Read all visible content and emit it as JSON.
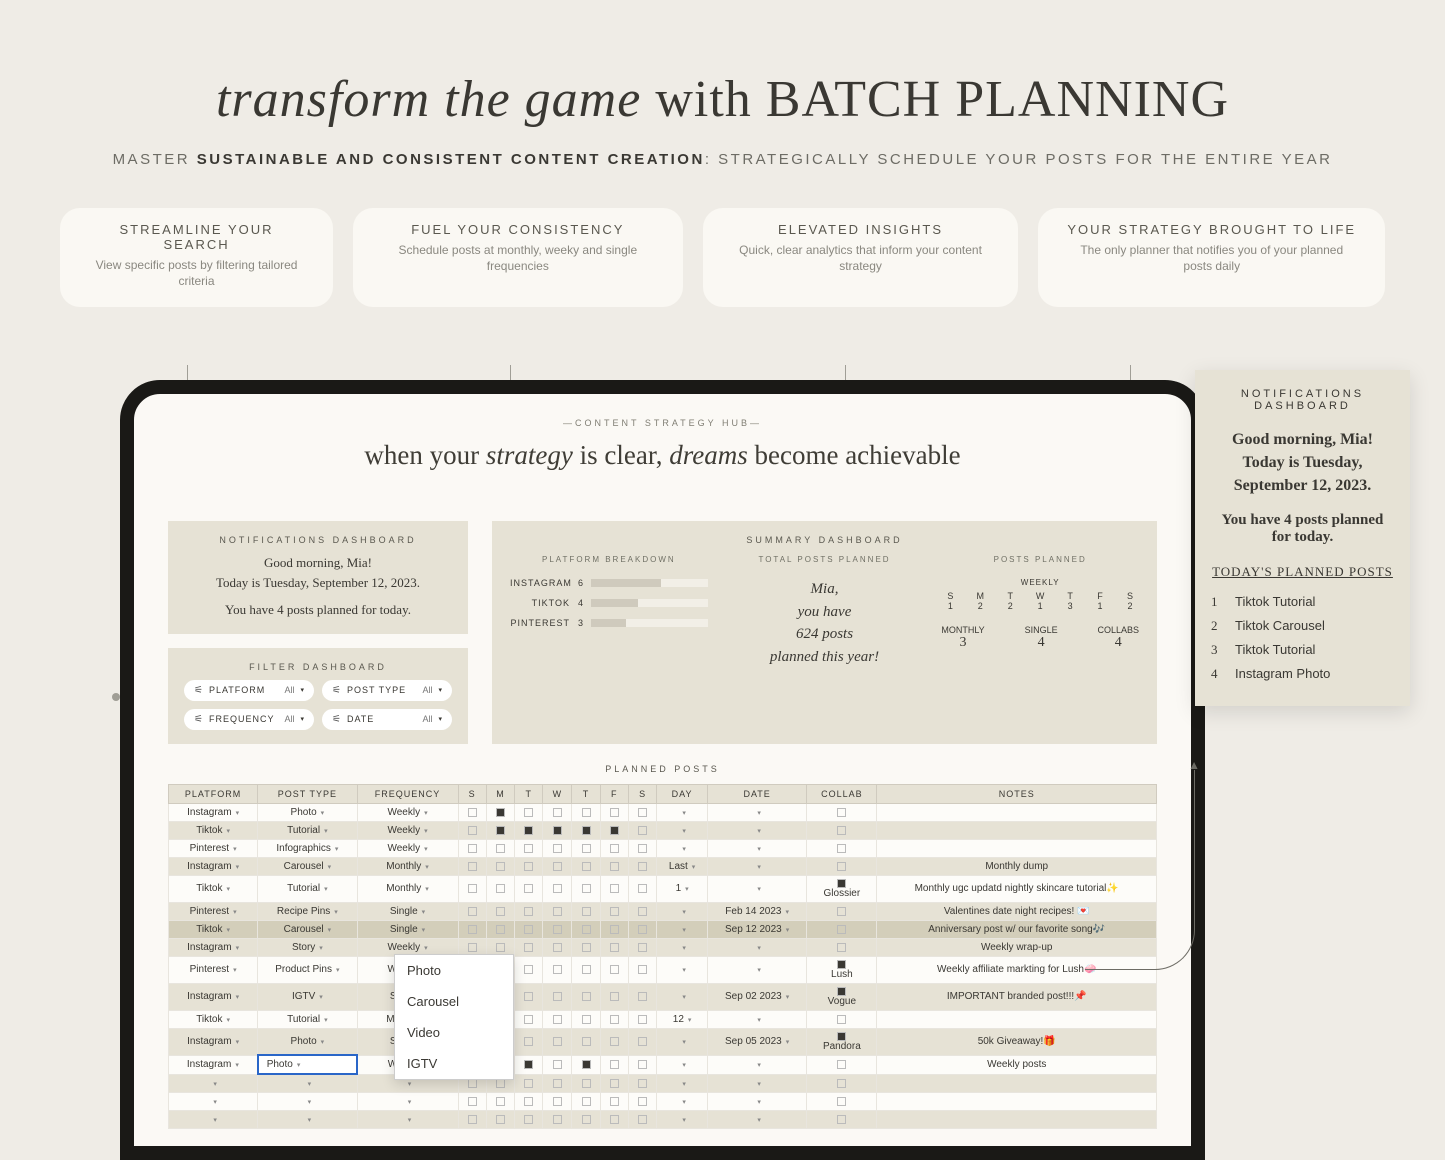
{
  "hero": {
    "title_italic": "transform the game",
    "title_join": " with ",
    "title_caps": "BATCH PLANNING"
  },
  "subhead": {
    "prefix": "MASTER ",
    "bold": "SUSTAINABLE AND CONSISTENT CONTENT CREATION",
    "suffix": ": STRATEGICALLY SCHEDULE YOUR POSTS FOR THE ENTIRE YEAR"
  },
  "pills": [
    {
      "title": "STREAMLINE YOUR SEARCH",
      "body": "View specific posts by filtering tailored criteria"
    },
    {
      "title": "FUEL YOUR CONSISTENCY",
      "body": "Schedule posts at monthly, weeky and single frequencies"
    },
    {
      "title": "ELEVATED INSIGHTS",
      "body": "Quick, clear analytics that inform your content strategy"
    },
    {
      "title": "YOUR STRATEGY BROUGHT TO LIFE",
      "body": "The only planner  that notifies you of your planned posts daily"
    }
  ],
  "hub": {
    "label": "—CONTENT STRATEGY HUB—",
    "tagline_pre": "when your ",
    "tagline_i1": "strategy",
    "tagline_mid": " is clear, ",
    "tagline_i2": "dreams",
    "tagline_post": " become achievable"
  },
  "notif_small": {
    "title": "NOTIFICATIONS DASHBOARD",
    "l1": "Good morning, Mia!",
    "l2": "Today is Tuesday, September 12, 2023.",
    "l3": "You have 4 posts planned for today."
  },
  "filter": {
    "title": "FILTER DASHBOARD",
    "chips": [
      {
        "label": "PLATFORM",
        "val": "All"
      },
      {
        "label": "POST TYPE",
        "val": "All"
      },
      {
        "label": "FREQUENCY",
        "val": "All"
      },
      {
        "label": "DATE",
        "val": "All"
      }
    ]
  },
  "summary": {
    "title": "SUMMARY DASHBOARD",
    "breakdown_title": "PLATFORM BREAKDOWN",
    "breakdown": [
      {
        "name": "INSTAGRAM",
        "n": "6",
        "pct": 60
      },
      {
        "name": "TIKTOK",
        "n": "4",
        "pct": 40
      },
      {
        "name": "PINTEREST",
        "n": "3",
        "pct": 30
      }
    ],
    "total_title": "TOTAL POSTS PLANNED",
    "total_lines": [
      "Mia,",
      "you have",
      "624 posts",
      "planned this year!"
    ],
    "planned_title": "POSTS PLANNED",
    "weekly_label": "WEEKLY",
    "days": [
      "S",
      "M",
      "T",
      "W",
      "T",
      "F",
      "S"
    ],
    "day_vals": [
      "1",
      "2",
      "2",
      "1",
      "3",
      "1",
      "2"
    ],
    "mini": [
      {
        "label": "MONTHLY",
        "n": "3"
      },
      {
        "label": "SINGLE",
        "n": "4"
      },
      {
        "label": "COLLABS",
        "n": "4"
      }
    ]
  },
  "table": {
    "title": "PLANNED POSTS",
    "headers": [
      "PLATFORM",
      "POST TYPE",
      "FREQUENCY",
      "S",
      "M",
      "T",
      "W",
      "T",
      "F",
      "S",
      "DAY",
      "DATE",
      "COLLAB",
      "NOTES"
    ],
    "rows": [
      {
        "alt": false,
        "plat": "Instagram",
        "type": "Photo",
        "freq": "Weekly",
        "days": [
          0,
          1,
          0,
          0,
          0,
          0,
          0
        ],
        "day": "",
        "date": "",
        "collab": false,
        "notes": ""
      },
      {
        "alt": true,
        "plat": "Tiktok",
        "type": "Tutorial",
        "freq": "Weekly",
        "days": [
          0,
          1,
          1,
          1,
          1,
          1,
          0
        ],
        "day": "",
        "date": "",
        "collab": false,
        "notes": ""
      },
      {
        "alt": false,
        "plat": "Pinterest",
        "type": "Infographics",
        "freq": "Weekly",
        "days": [
          0,
          0,
          0,
          0,
          0,
          0,
          0
        ],
        "day": "",
        "date": "",
        "collab": false,
        "notes": ""
      },
      {
        "alt": true,
        "plat": "Instagram",
        "type": "Carousel",
        "freq": "Monthly",
        "days": [
          0,
          0,
          0,
          0,
          0,
          0,
          0
        ],
        "day": "Last",
        "date": "",
        "collab": false,
        "notes": "Monthly dump"
      },
      {
        "alt": false,
        "plat": "Tiktok",
        "type": "Tutorial",
        "freq": "Monthly",
        "days": [
          0,
          0,
          0,
          0,
          0,
          0,
          0
        ],
        "day": "1",
        "date": "",
        "collab": true,
        "collab_name": "Glossier",
        "notes": "Monthly ugc updatd nightly skincare tutorial✨"
      },
      {
        "alt": true,
        "plat": "Pinterest",
        "type": "Recipe Pins",
        "freq": "Single",
        "days": [
          0,
          0,
          0,
          0,
          0,
          0,
          0
        ],
        "day": "",
        "date": "Feb 14 2023",
        "collab": false,
        "notes": "Valentines date night recipes! 💌"
      },
      {
        "alt": false,
        "sel": true,
        "plat": "Tiktok",
        "type": "Carousel",
        "freq": "Single",
        "days": [
          0,
          0,
          0,
          0,
          0,
          0,
          0
        ],
        "day": "",
        "date": "Sep 12 2023",
        "collab": false,
        "notes": "Anniversary post w/ our favorite song🎶"
      },
      {
        "alt": true,
        "plat": "Instagram",
        "type": "Story",
        "freq": "Weekly",
        "days": [
          0,
          0,
          0,
          0,
          0,
          0,
          0
        ],
        "day": "",
        "date": "",
        "collab": false,
        "notes": "Weekly wrap-up"
      },
      {
        "alt": false,
        "plat": "Pinterest",
        "type": "Product Pins",
        "freq": "Weekly",
        "days": [
          0,
          0,
          0,
          0,
          0,
          0,
          0
        ],
        "day": "",
        "date": "",
        "collab": true,
        "collab_name": "Lush",
        "notes": "Weekly affiliate markting for Lush🧼"
      },
      {
        "alt": true,
        "plat": "Instagram",
        "type": "IGTV",
        "freq": "Single",
        "days": [
          0,
          0,
          0,
          0,
          0,
          0,
          0
        ],
        "day": "",
        "date": "Sep 02 2023",
        "collab": true,
        "collab_name": "Vogue",
        "notes": "IMPORTANT branded post!!!📌"
      },
      {
        "alt": false,
        "plat": "Tiktok",
        "type": "Tutorial",
        "freq": "Monthly",
        "days": [
          0,
          0,
          0,
          0,
          0,
          0,
          0
        ],
        "day": "12",
        "date": "",
        "collab": false,
        "notes": ""
      },
      {
        "alt": true,
        "plat": "Instagram",
        "type": "Photo",
        "freq": "Single",
        "days": [
          0,
          0,
          0,
          0,
          0,
          0,
          0
        ],
        "day": "",
        "date": "Sep 05 2023",
        "collab": true,
        "collab_name": "Pandora",
        "notes": "50k Giveaway!🎁"
      },
      {
        "alt": false,
        "edit": true,
        "plat": "Instagram",
        "type": "Photo",
        "freq": "Weekly",
        "days": [
          0,
          0,
          1,
          0,
          1,
          0,
          0
        ],
        "day": "",
        "date": "",
        "collab": false,
        "notes": "Weekly posts"
      },
      {
        "alt": true,
        "plat": "",
        "type": "",
        "freq": "",
        "days": [
          0,
          0,
          0,
          0,
          0,
          0,
          0
        ],
        "day": "",
        "date": "",
        "collab": false,
        "notes": ""
      },
      {
        "alt": false,
        "plat": "",
        "type": "",
        "freq": "",
        "days": [
          0,
          0,
          0,
          0,
          0,
          0,
          0
        ],
        "day": "",
        "date": "",
        "collab": false,
        "notes": ""
      },
      {
        "alt": true,
        "plat": "",
        "type": "",
        "freq": "",
        "days": [
          0,
          0,
          0,
          0,
          0,
          0,
          0
        ],
        "day": "",
        "date": "",
        "collab": false,
        "notes": ""
      }
    ],
    "dropdown": [
      "Photo",
      "Carousel",
      "Video",
      "IGTV"
    ]
  },
  "notif_big": {
    "title": "NOTIFICATIONS DASHBOARD",
    "gm": "Good morning, Mia! Today is Tuesday, September 12, 2023.",
    "sub": "You have 4 posts planned for today.",
    "sect": "TODAY'S PLANNED POSTS",
    "items": [
      "Tiktok Tutorial",
      "Tiktok Carousel",
      "Tiktok Tutorial",
      "Instagram Photo"
    ]
  }
}
